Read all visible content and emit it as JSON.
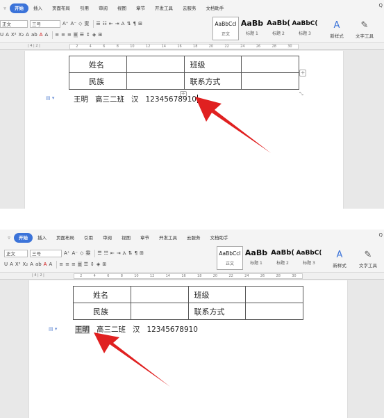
{
  "tabs": [
    "开始",
    "插入",
    "页面布局",
    "引用",
    "审阅",
    "视图",
    "章节",
    "开发工具",
    "云服务",
    "文档助手"
  ],
  "active_tab": "开始",
  "font_name": "正文",
  "font_size": "三号",
  "styles": [
    {
      "preview": "AaBbCcI",
      "name": "正文"
    },
    {
      "preview": "AaBb",
      "name": "标题 1"
    },
    {
      "preview": "AaBb(",
      "name": "标题 2"
    },
    {
      "preview": "AaBbC(",
      "name": "标题 3"
    }
  ],
  "new_style_label": "新样式",
  "text_tool_label": "文字工具",
  "table": {
    "row1": {
      "c1": "姓名",
      "c3": "班级"
    },
    "row2": {
      "c1": "民族",
      "c3": "联系方式"
    }
  },
  "text_line": {
    "name": "王明",
    "class": "高三二班",
    "ethnicity": "汉",
    "phone": "12345678910"
  },
  "colors": {
    "accent": "#3b73d9",
    "arrow": "#e02020"
  }
}
